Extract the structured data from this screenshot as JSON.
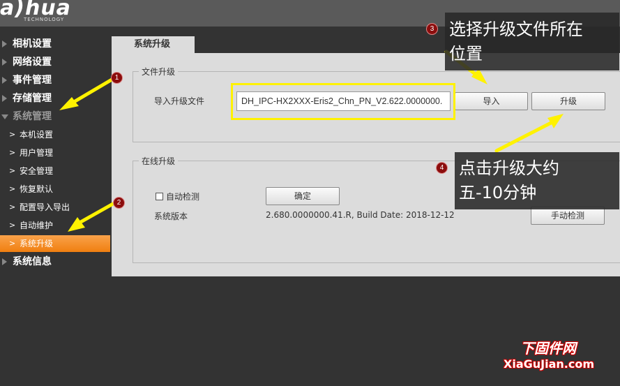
{
  "brand": {
    "logo": "a)hua",
    "tagline": "TECHNOLOGY"
  },
  "sidebar": {
    "items": [
      {
        "label": "相机设置",
        "open": false
      },
      {
        "label": "网络设置",
        "open": false
      },
      {
        "label": "事件管理",
        "open": false
      },
      {
        "label": "存储管理",
        "open": false
      },
      {
        "label": "系统管理",
        "open": true
      }
    ],
    "subitems": [
      {
        "label": "本机设置",
        "active": false
      },
      {
        "label": "用户管理",
        "active": false
      },
      {
        "label": "安全管理",
        "active": false
      },
      {
        "label": "恢复默认",
        "active": false
      },
      {
        "label": "配置导入导出",
        "active": false
      },
      {
        "label": "自动维护",
        "active": false
      },
      {
        "label": "系统升级",
        "active": true
      }
    ],
    "after": {
      "label": "系统信息"
    }
  },
  "tab": {
    "label": "系统升级"
  },
  "file_upgrade": {
    "title": "文件升级",
    "import_label": "导入升级文件",
    "file_value": "DH_IPC-HX2XXX-Eris2_Chn_PN_V2.622.0000000.",
    "import_button": "导入",
    "upgrade_button": "升级"
  },
  "online_upgrade": {
    "title": "在线升级",
    "auto_check_label": "自动检测",
    "confirm_button": "确定",
    "version_label": "系统版本",
    "version_value": "2.680.0000000.41.R, Build Date: 2018-12-12",
    "manual_check_button": "手动检测"
  },
  "annotations": {
    "badges": [
      "1",
      "2",
      "3",
      "4"
    ],
    "callout3": {
      "line1": "选择升级文件所在",
      "line2": "位置"
    },
    "callout4": {
      "line1": "点击升级大约",
      "line2": "五-10分钟"
    },
    "arrow_color": "#fff200",
    "highlight_color": "#fff200"
  },
  "watermark": {
    "line1": "下固件网",
    "line2": "XiaGuJian.com"
  },
  "colors": {
    "accent": "#f7941d",
    "background": "#333333",
    "panel": "#dcdcdc",
    "badge": "#8b0d0d"
  }
}
